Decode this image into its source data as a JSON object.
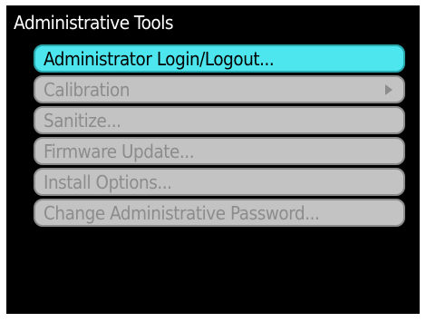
{
  "menu": {
    "title": "Administrative Tools",
    "items": [
      {
        "label": "Administrator Login/Logout...",
        "selected": true,
        "enabled": true,
        "has_submenu": false
      },
      {
        "label": "Calibration",
        "selected": false,
        "enabled": false,
        "has_submenu": true
      },
      {
        "label": "Sanitize...",
        "selected": false,
        "enabled": false,
        "has_submenu": false
      },
      {
        "label": "Firmware Update...",
        "selected": false,
        "enabled": false,
        "has_submenu": false
      },
      {
        "label": "Install Options...",
        "selected": false,
        "enabled": false,
        "has_submenu": false
      },
      {
        "label": "Change Administrative Password...",
        "selected": false,
        "enabled": false,
        "has_submenu": false
      }
    ]
  },
  "icons": {
    "submenu": "chevron-right-icon"
  },
  "colors": {
    "background": "#000000",
    "title_text": "#ffffff",
    "selected_fill": "#4ee6ee",
    "disabled_fill": "#c3c3c3",
    "disabled_text": "#8c8c8c"
  }
}
